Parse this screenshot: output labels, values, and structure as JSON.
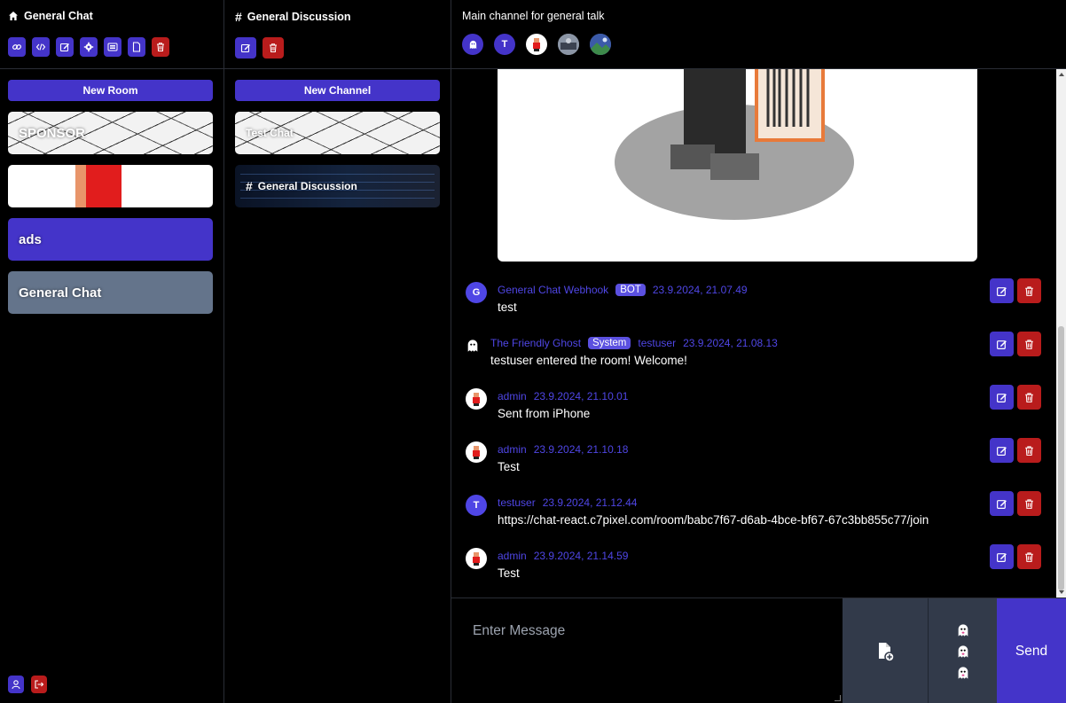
{
  "rooms_panel": {
    "title": "General Chat",
    "new_button": "New Room",
    "rooms": [
      {
        "label": "SPONSOR"
      },
      {
        "label": ""
      },
      {
        "label": "ads"
      },
      {
        "label": "General Chat"
      }
    ]
  },
  "channels_panel": {
    "title": "General Discussion",
    "new_button": "New Channel",
    "channels": [
      {
        "label": "Test Chat"
      },
      {
        "label": "General Discussion"
      }
    ]
  },
  "chat": {
    "topic": "Main channel for general talk",
    "members": [
      {
        "initial": ""
      },
      {
        "initial": "T"
      },
      {
        "initial": ""
      },
      {
        "initial": ""
      },
      {
        "initial": ""
      }
    ],
    "messages": [
      {
        "author": "General Chat Webhook",
        "badge": "BOT",
        "initial": "G",
        "timestamp": "23.9.2024, 21.07.49",
        "text": "test"
      },
      {
        "author": "The Friendly Ghost",
        "badge": "System",
        "mention": "testuser",
        "timestamp": "23.9.2024, 21.08.13",
        "text": "testuser entered the room! Welcome!"
      },
      {
        "author": "admin",
        "timestamp": "23.9.2024, 21.10.01",
        "text": "Sent from iPhone"
      },
      {
        "author": "admin",
        "timestamp": "23.9.2024, 21.10.18",
        "text": "Test"
      },
      {
        "author": "testuser",
        "initial": "T",
        "timestamp": "23.9.2024, 21.12.44",
        "text": "https://chat-react.c7pixel.com/room/babc7f67-d6ab-4bce-bf67-67c3bb855c77/join"
      },
      {
        "author": "admin",
        "timestamp": "23.9.2024, 21.14.59",
        "text": "Test"
      }
    ],
    "composer": {
      "placeholder": "Enter Message",
      "send_label": "Send"
    }
  },
  "colors": {
    "accent": "#4434c9",
    "danger": "#b91c1c",
    "username": "#4f46e5",
    "selected_room": "#64748b",
    "avatar_default": "#4f46e5"
  }
}
